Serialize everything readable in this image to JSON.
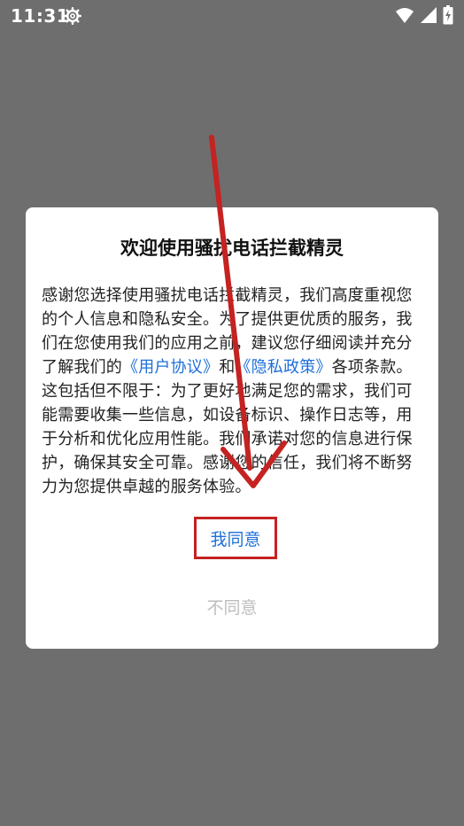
{
  "status_bar": {
    "time": "11:31",
    "settings_icon": "gear-icon",
    "wifi_icon": "wifi-icon",
    "signal_icon": "signal-icon",
    "battery_icon": "battery-charging-icon"
  },
  "dialog": {
    "title": "欢迎使用骚扰电话拦截精灵",
    "body_before_user_link": "感谢您选择使用骚扰电话拦截精灵，我们高度重视您的个人信息和隐私安全。为了提供更优质的服务，我们在您使用我们的应用之前，建议您仔细阅读并充分了解我们的",
    "user_agreement_link": "《用户协议》",
    "body_between_links": "和",
    "privacy_policy_link": "《隐私政策》",
    "body_after_links": "各项条款。这包括但不限于：为了更好地满足您的需求，我们可能需要收集一些信息，如设备标识、操作日志等，用于分析和优化应用性能。我们承诺对您的信息进行保护，确保其安全可靠。感谢您的信任，我们将不断努力为您提供卓越的服务体验。",
    "agree_label": "我同意",
    "disagree_label": "不同意"
  },
  "colors": {
    "overlay": "#6e6e6e",
    "link": "#1e6fd9",
    "annotation": "#c52222",
    "disabled_text": "#bdbdbd"
  }
}
